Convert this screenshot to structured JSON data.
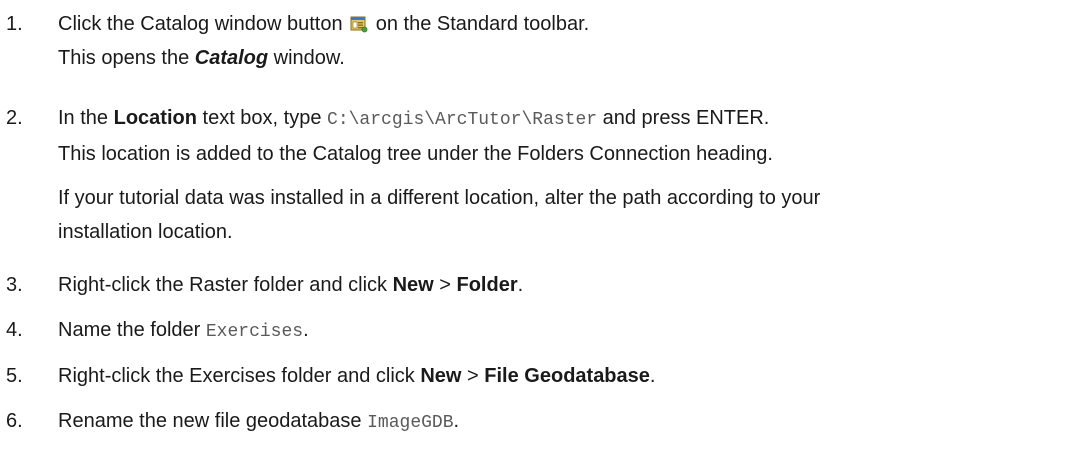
{
  "steps": [
    {
      "number": "1.",
      "line1_before": "Click the Catalog window button ",
      "icon": "catalog-window-icon",
      "line1_after": " on the Standard toolbar.",
      "line2_before": "This opens the ",
      "line2_emph": "Catalog",
      "line2_after": " window."
    },
    {
      "number": "2.",
      "line1_before": "In the ",
      "line1_bold": "Location",
      "line1_mid": " text box, type ",
      "line1_code": "C:\\arcgis\\ArcTutor\\Raster",
      "line1_after": " and press ENTER.",
      "line2": "This location is added to the Catalog tree under the Folders Connection heading.",
      "note_line1": "If your tutorial data was installed in a different location, alter the path according to your",
      "note_line2": "installation location."
    },
    {
      "number": "3.",
      "text_before": "Right-click the Raster folder and click ",
      "bold1": "New",
      "sep": " > ",
      "bold2": "Folder",
      "text_after": "."
    },
    {
      "number": "4.",
      "text_before": "Name the folder ",
      "code": "Exercises",
      "text_after": "."
    },
    {
      "number": "5.",
      "text_before": "Right-click the Exercises folder and click ",
      "bold1": "New",
      "sep": " > ",
      "bold2": "File Geodatabase",
      "text_after": "."
    },
    {
      "number": "6.",
      "text_before": "Rename the new file geodatabase ",
      "code": "ImageGDB",
      "text_after": "."
    }
  ]
}
